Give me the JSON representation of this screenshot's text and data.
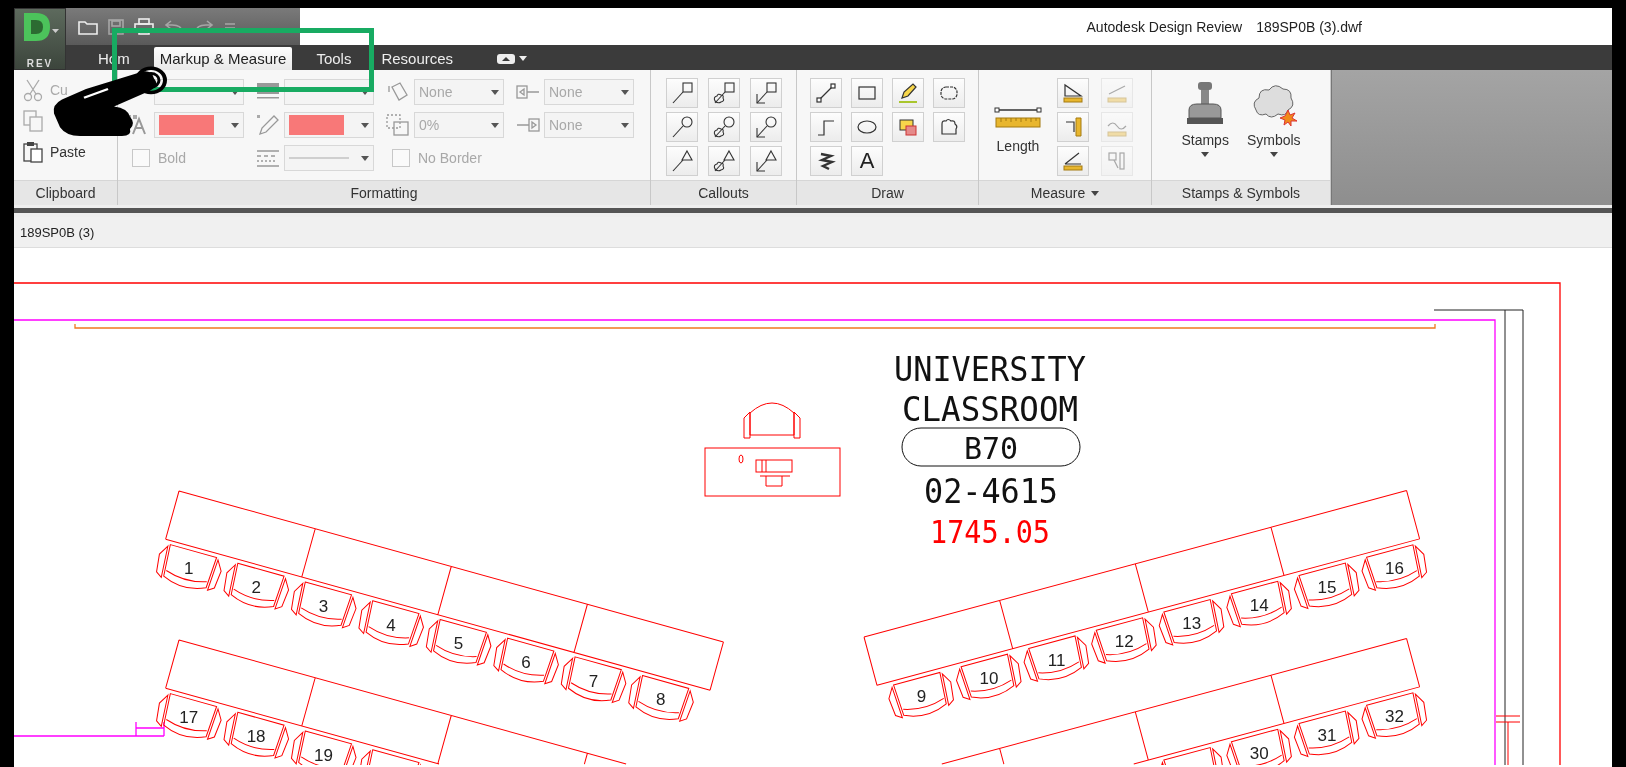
{
  "app_button": {
    "label": "REV"
  },
  "quick_access": [
    {
      "kind": "open",
      "disabled": false
    },
    {
      "kind": "save",
      "disabled": true
    },
    {
      "kind": "print",
      "disabled": false
    },
    {
      "kind": "undo",
      "disabled": true
    },
    {
      "kind": "redo",
      "disabled": true
    },
    {
      "kind": "customize",
      "disabled": true
    }
  ],
  "title_bar": {
    "app_name": "Autodesk Design Review",
    "file_name": "189SP0B (3).dwf"
  },
  "tabs": [
    {
      "label": "Hom",
      "selected": false
    },
    {
      "label": "Markup & Measure",
      "selected": true
    },
    {
      "label": "Tools",
      "selected": false
    },
    {
      "label": "Resources",
      "selected": false
    }
  ],
  "ribbon": {
    "clipboard": {
      "title": "Clipboard",
      "items": [
        {
          "kind": "cut",
          "label": "Cu",
          "disabled": true
        },
        {
          "kind": "copy",
          "disabled": true
        },
        {
          "kind": "paste",
          "label": "Paste",
          "disabled": false
        }
      ]
    },
    "formatting": {
      "title": "Formatting",
      "columns": [
        [
          {
            "kind": "field",
            "disabled": true
          },
          {
            "kind": "color",
            "color": "#f87878",
            "disabled": true
          },
          {
            "kind": "checkbox",
            "label": "Bold",
            "checked": false,
            "disabled": true
          }
        ],
        [
          {
            "kind": "field",
            "disabled": true
          },
          {
            "kind": "color",
            "color": "#f87878",
            "disabled": true
          },
          {
            "kind": "line-style",
            "disabled": true
          }
        ],
        [
          {
            "kind": "field",
            "value": "None",
            "disabled": true
          },
          {
            "kind": "field",
            "value": "0%",
            "disabled": true
          },
          {
            "kind": "checkbox",
            "label": "No Border",
            "checked": false,
            "disabled": true
          }
        ],
        [
          {
            "kind": "field",
            "value": "None",
            "disabled": true
          },
          {
            "kind": "field",
            "value": "None",
            "disabled": true
          }
        ]
      ]
    },
    "callouts": {
      "title": "Callouts"
    },
    "draw": {
      "title": "Draw",
      "text_tool": "A"
    },
    "measure": {
      "title": "Measure",
      "main": {
        "label": "Length"
      },
      "tools": [
        {
          "disabled": false
        },
        {
          "disabled": false
        },
        {
          "disabled": false
        },
        {
          "disabled": true
        },
        {
          "disabled": true
        },
        {
          "disabled": true
        }
      ]
    },
    "stamps": {
      "title": "Stamps & Symbols",
      "buttons": [
        {
          "kind": "stamp",
          "label": "Stamps"
        },
        {
          "kind": "symbol",
          "label": "Symbols"
        }
      ]
    }
  },
  "document_tab": {
    "label": "189SP0B (3)"
  },
  "drawing": {
    "title_lines": [
      "UNIVERSITY",
      "CLASSROOM"
    ],
    "room": "B70",
    "code": "02-4615",
    "area": "1745.05",
    "seat_rows": [
      {
        "seats": [
          "1",
          "2",
          "3",
          "4",
          "5",
          "6",
          "7",
          "8"
        ]
      },
      {
        "seats": [
          "9",
          "10",
          "11",
          "12",
          "13",
          "14",
          "15",
          "16"
        ]
      },
      {
        "seats": [
          "17",
          "18",
          "19"
        ]
      },
      {
        "seats": [
          "30",
          "31",
          "32"
        ]
      }
    ]
  },
  "overlay": {
    "highlight": true,
    "pointer": true
  }
}
